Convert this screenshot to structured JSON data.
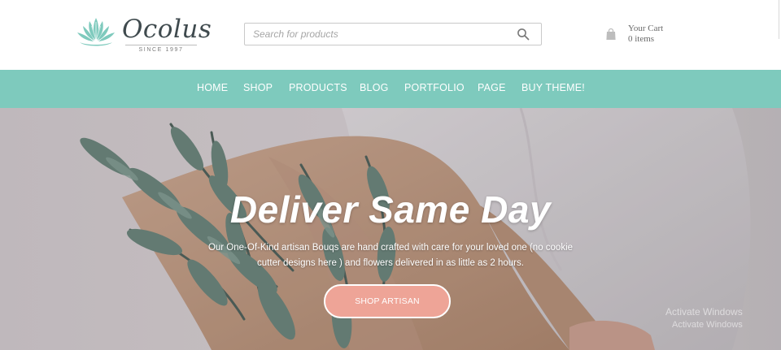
{
  "header": {
    "logo": {
      "name": "Ocolus",
      "tagline": "SINCE 1997",
      "icon": "lotus-logo-icon"
    },
    "search": {
      "placeholder": "Search for products",
      "value": "",
      "icon": "search-icon"
    },
    "cart": {
      "title": "Your Cart",
      "count": "0 items",
      "icon": "shopping-bag-icon"
    }
  },
  "nav": {
    "items": [
      {
        "label": "HOME"
      },
      {
        "label": "SHOP"
      },
      {
        "label": "PRODUCTS"
      },
      {
        "label": "BLOG"
      },
      {
        "label": "PORTFOLIO"
      },
      {
        "label": "PAGE"
      },
      {
        "label": "BUY THEME!"
      }
    ]
  },
  "hero": {
    "title": "Deliver Same Day",
    "subtitle": "Our One-Of-Kind artisan Bouqs are hand crafted with care for your loved one (no cookie cutter designs here ) and flowers delivered in as little as 2 hours.",
    "button": "SHOP ARTISAN",
    "watermark_line1": "Activate Windows",
    "watermark_line2": "Activate Windows"
  },
  "colors": {
    "nav_bg": "#7ecabd",
    "logo_teal": "#7ecabd",
    "button_bg": "#eea497",
    "text_dark": "#3f4a4e"
  }
}
